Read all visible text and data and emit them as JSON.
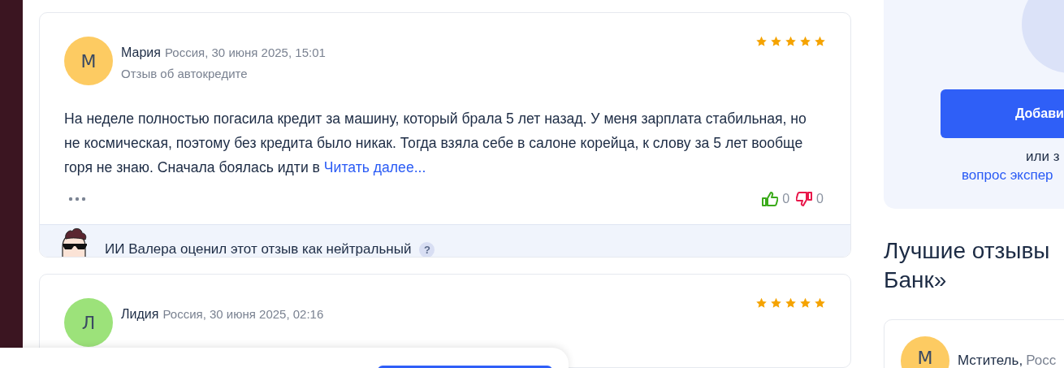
{
  "reviews": [
    {
      "avatar_letter": "М",
      "color": "#fdcb62",
      "author": "Мария",
      "meta": "Россия, 30 июня 2025, 15:01",
      "subject": "Отзыв об автокредите",
      "stars": 5,
      "text": "На неделе полностью погасила кредит за машину, который брала 5 лет назад. У меня зарплата стабильная, но не космическая, поэтому без кредита было никак. Тогда взяла себе в салоне корейца, к слову за 5 лет вообще горя не знаю. Сначала боялась идти в",
      "read_more": "Читать далее...",
      "likes": "0",
      "dislikes": "0",
      "ai_verdict": "ИИ Валера оценил этот отзыв как нейтральный",
      "ai_help": "?"
    },
    {
      "avatar_letter": "Л",
      "color": "#9ce27a",
      "author": "Лидия",
      "meta": "Россия, 30 июня 2025, 02:16",
      "stars": 5
    }
  ],
  "sidebar": {
    "add_button": "Добави",
    "or_text": "или з",
    "ask_link": "вопрос экспер",
    "best_heading": [
      "Лучшие отзывы",
      "Банк»"
    ],
    "best_review": {
      "avatar_letter": "М",
      "color": "#fdcb62",
      "author": "Мститель,",
      "meta": "Росс"
    }
  }
}
